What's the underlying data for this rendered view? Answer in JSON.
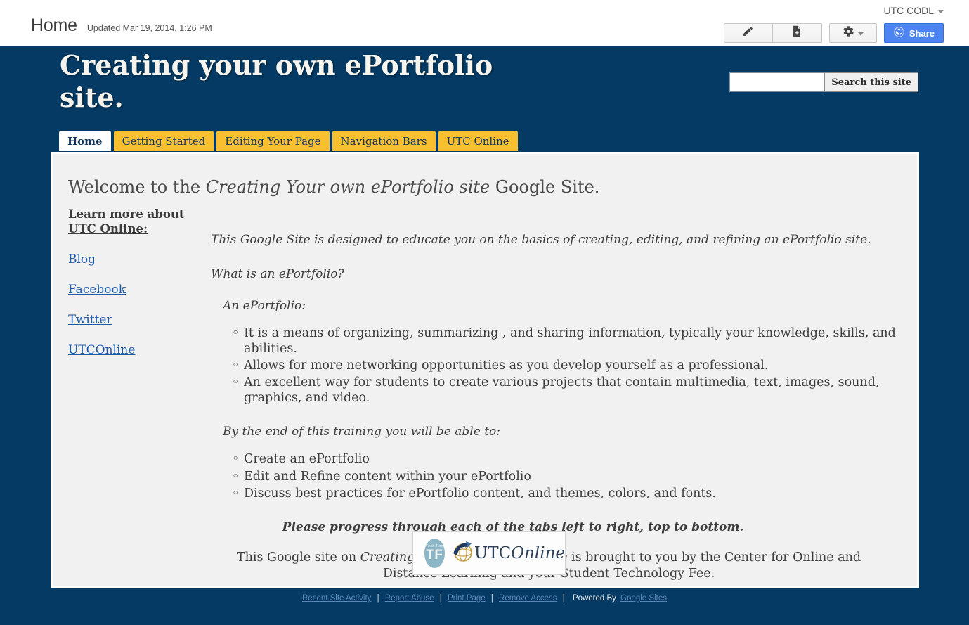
{
  "topbar": {
    "page_title": "Home",
    "updated": "Updated Mar 19, 2014, 1:26 PM",
    "account": "UTC CODL",
    "buttons": {
      "edit_page": "edit-pencil",
      "new_page": "new-page",
      "more_actions": "gear",
      "share": "Share"
    }
  },
  "site": {
    "title": "Creating your own ePortfolio site.",
    "accent_navy": "#043a63",
    "accent_gold": "#f8c02e",
    "share_blue": "#4d84f3",
    "link_blue": "#1f5ca8"
  },
  "search": {
    "value": "",
    "placeholder": "",
    "button_label": "Search this site"
  },
  "tabs": [
    {
      "label": "Home",
      "active": true
    },
    {
      "label": "Getting Started",
      "active": false
    },
    {
      "label": "Editing Your Page",
      "active": false
    },
    {
      "label": "Navigation Bars",
      "active": false
    },
    {
      "label": "UTC Online",
      "active": false
    }
  ],
  "content": {
    "welcome_pre": "Welcome to the ",
    "welcome_em": "Creating Your own ePortfolio site",
    "welcome_post": " Google Site.",
    "sidebar": {
      "heading": "Learn more about UTC Online:",
      "links": [
        {
          "label": "Blog"
        },
        {
          "label": "Facebook"
        },
        {
          "label": "Twitter"
        },
        {
          "label": "UTCOnline"
        }
      ]
    },
    "intro": "This Google Site is designed to educate you on the basics of creating, editing, and refining an ePortfolio site.",
    "question": "What is an ePortfolio?",
    "definition_lead": "An ePortfolio:",
    "definition_items": [
      "It is a means of organizing, summarizing , and sharing information, typically your knowledge, skills, and abilities.",
      "Allows for more networking opportunities as you develop yourself as a professional.",
      "An excellent way for students to create various projects that contain multimedia, text, images, sound, graphics, and video."
    ],
    "outcomes_lead": "By the end of this training you will be able to:",
    "outcomes_items": [
      "Create an ePortfolio",
      "Edit and Refine content within your ePortfolio",
      "Discuss best practices for ePortfolio content, and themes, colors, and fonts."
    ],
    "instruction": "Please progress through each of the tabs left to right, top to bottom.",
    "closing_pre": "This Google site on ",
    "closing_em": "Creating your own ePortfolio site",
    "closing_post": " is brought to you by the Center for Online and Distance Learning and your Student Technology Fee.",
    "logo": {
      "tech_fee_small": "Tech Fee",
      "tech_fee_big": "TF",
      "utc": "UTC",
      "online": "Online"
    }
  },
  "footer": {
    "links": [
      {
        "label": "Recent Site Activity"
      },
      {
        "label": "Report Abuse"
      },
      {
        "label": "Print Page"
      },
      {
        "label": "Remove Access"
      }
    ],
    "separator": "|",
    "powered_by": "Powered By",
    "powered_link": "Google Sites"
  }
}
